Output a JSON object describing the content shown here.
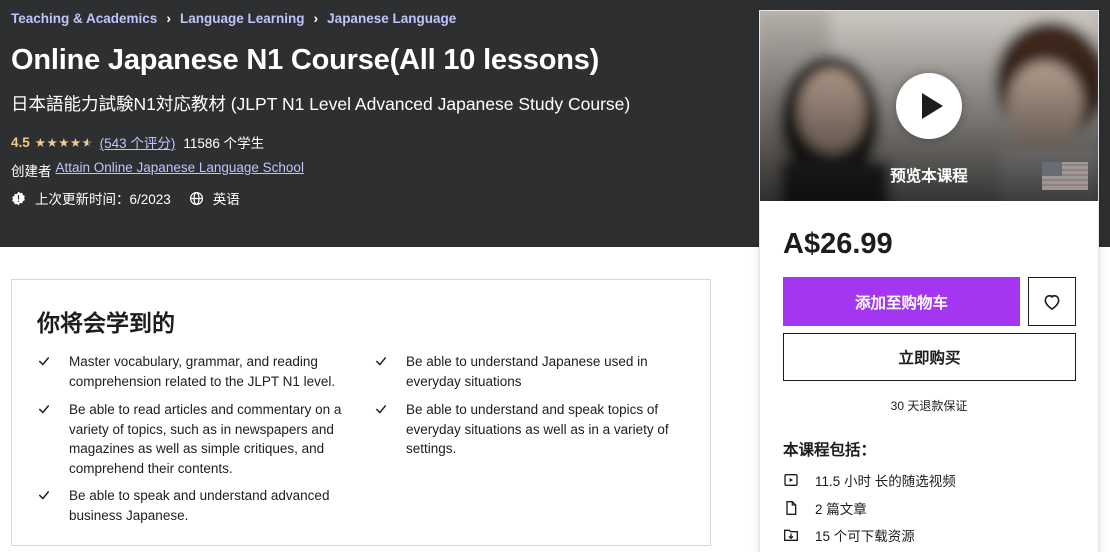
{
  "breadcrumb": {
    "items": [
      "Teaching & Academics",
      "Language Learning",
      "Japanese Language"
    ]
  },
  "course": {
    "title": "Online Japanese N1 Course(All 10 lessons)",
    "subtitle": "日本語能力試験N1対応教材 (JLPT N1 Level Advanced Japanese Study Course)",
    "rating": "4.5",
    "stars": 4.5,
    "rating_count": "(543 个评分)",
    "students": "11586 个学生",
    "creator_label": "创建者",
    "creator_name": "Attain Online Japanese Language School",
    "last_updated": "上次更新时间：6/2023",
    "language": "英语"
  },
  "learn": {
    "title": "你将会学到的",
    "items": [
      "Master vocabulary, grammar, and reading comprehension related to the JLPT N1 level.",
      "Be able to understand Japanese used in everyday situations",
      "Be able to read articles and commentary on a variety of topics, such as in newspapers and magazines as well as simple critiques, and comprehend their contents.",
      "Be able to understand and speak topics of everyday situations as well as in a variety of settings.",
      "Be able to speak and understand advanced business Japanese."
    ]
  },
  "sidebar": {
    "preview_label": "预览本课程",
    "price": "A$26.99",
    "add_to_cart": "添加至购物车",
    "buy_now": "立即购买",
    "guarantee": "30 天退款保证",
    "includes_title": "本课程包括：",
    "includes": [
      {
        "icon": "video-icon",
        "text": "11.5 小时 长的随选视频"
      },
      {
        "icon": "article-icon",
        "text": "2 篇文章"
      },
      {
        "icon": "download-icon",
        "text": "15 个可下载资源"
      }
    ]
  },
  "colors": {
    "hero_bg": "#2d2f31",
    "link_purple": "#c0c4fc",
    "star_gold": "#f3ca8c",
    "cart_purple": "#a435f0"
  }
}
